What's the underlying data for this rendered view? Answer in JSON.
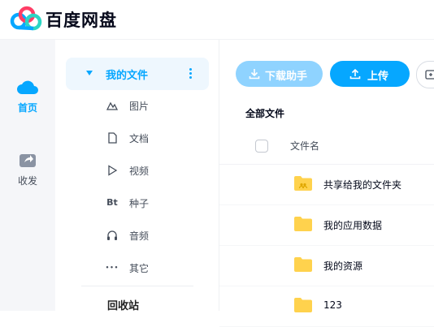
{
  "app": {
    "title": "百度网盘"
  },
  "left_nav": {
    "items": [
      {
        "label": "首页",
        "icon": "cloud-icon",
        "active": true
      },
      {
        "label": "收发",
        "icon": "share-icon",
        "active": false
      }
    ]
  },
  "sidebar": {
    "header": {
      "label": "我的文件",
      "icon": "caret-down-icon",
      "more_icon": "more-vertical-icon"
    },
    "categories": [
      {
        "label": "图片",
        "icon": "image-icon"
      },
      {
        "label": "文档",
        "icon": "document-icon"
      },
      {
        "label": "视频",
        "icon": "video-icon"
      },
      {
        "label": "种子",
        "icon": "bt-icon",
        "glyph": "Bt"
      },
      {
        "label": "音频",
        "icon": "headphones-icon"
      },
      {
        "label": "其它",
        "icon": "ellipsis-icon",
        "glyph": "•••"
      }
    ],
    "recycle": "回收站"
  },
  "toolbar": {
    "download_label": "下载助手",
    "upload_label": "上传",
    "colors": {
      "primary": "#06a7ff",
      "disabled": "#8fd3ff"
    }
  },
  "breadcrumb": "全部文件",
  "table": {
    "column_name": "文件名",
    "rows": [
      {
        "name": "共享给我的文件夹",
        "icon": "shared-folder-icon"
      },
      {
        "name": "我的应用数据",
        "icon": "folder-icon"
      },
      {
        "name": "我的资源",
        "icon": "folder-icon"
      },
      {
        "name": "123",
        "icon": "folder-icon"
      }
    ]
  }
}
